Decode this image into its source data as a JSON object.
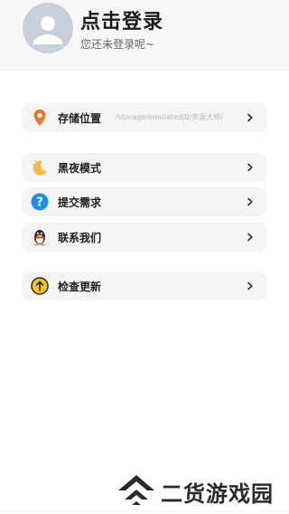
{
  "header": {
    "title": "点击登录",
    "subtitle": "您还未登录呢~"
  },
  "menu": [
    {
      "label": "存储位置",
      "value": "/storage/emulated/0/资源大师/",
      "icon": "location-pin-icon"
    },
    {
      "label": "黑夜模式",
      "icon": "moon-icon"
    },
    {
      "label": "提交需求",
      "icon": "question-icon"
    },
    {
      "label": "联系我们",
      "icon": "qq-penguin-icon"
    },
    {
      "label": "检查更新",
      "icon": "update-arrow-icon"
    }
  ],
  "watermark": {
    "text": "二货游戏园"
  },
  "colors": {
    "location": "#e8762f",
    "moon": "#f5b94a",
    "question": "#1e8ee8",
    "update": "#f7c81e",
    "watermark": "#2a2a2a"
  }
}
